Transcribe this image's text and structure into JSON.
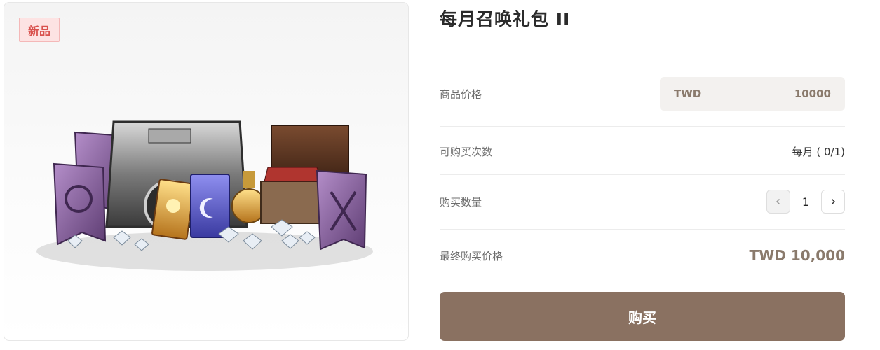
{
  "product": {
    "badge": "新品",
    "title": "每月召唤礼包 II",
    "image_icon": "bundle-chest-icon"
  },
  "details": {
    "price_label": "商品价格",
    "price_currency": "TWD",
    "price_amount": "10000",
    "purchase_limit_label": "可购买次数",
    "purchase_limit_value": "每月 ( 0/1)",
    "quantity_label": "购买数量",
    "quantity_value": "1",
    "final_price_label": "最终购买价格",
    "final_price_value": "TWD 10,000"
  },
  "actions": {
    "decrement_icon": "chevron-left-icon",
    "increment_icon": "chevron-right-icon",
    "buy_label": "购买"
  },
  "colors": {
    "badge_text": "#d9534f",
    "accent": "#8a7a6c",
    "buy_button": "#8a7161"
  }
}
